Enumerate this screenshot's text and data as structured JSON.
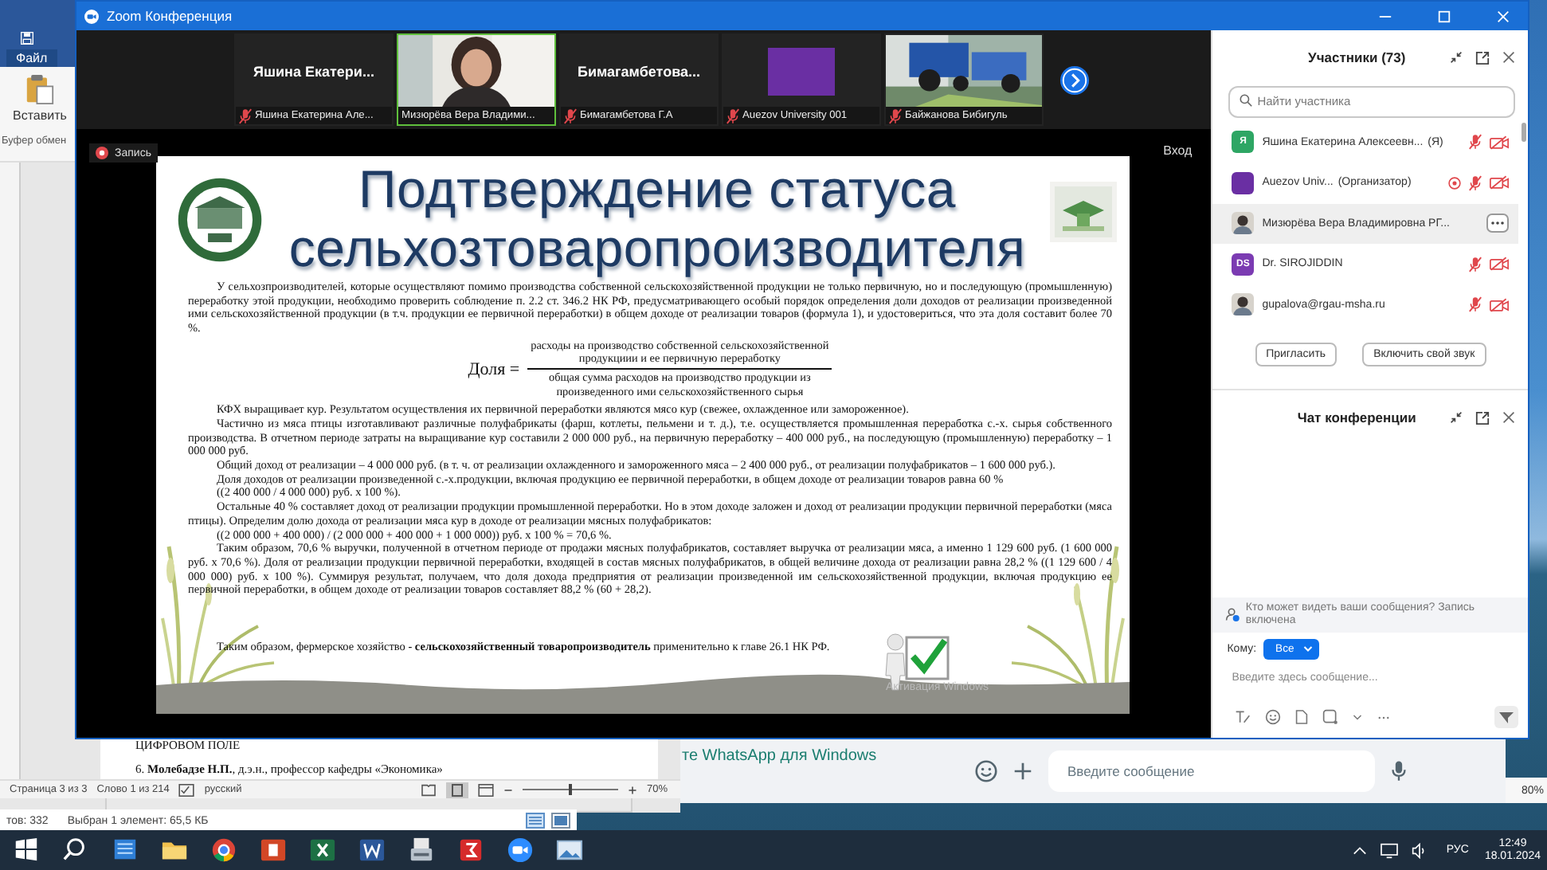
{
  "word_window": {
    "file_tab": "Файл",
    "paste_button": "Вставить",
    "clipboard_group": "Буфер обмен",
    "document_lines": [
      "ЦИФРОВОМ ПОЛЕ",
      "6. **Молебадзе Н.П.**, д.э.н., профессор кафедры «Экономика»"
    ],
    "status_bar": {
      "page": "Страница 3 из 3",
      "words": "Слово 1 из 214",
      "language": "русский",
      "zoom": "70%",
      "zoom_slider": {
        "level": 0.5
      }
    }
  },
  "explorer_status": {
    "items_count": "тов: 332",
    "selection": "Выбран 1 элемент: 65,5 КБ"
  },
  "whatsapp": {
    "banner": "те WhatsApp для Windows",
    "message_placeholder": "Введите сообщение"
  },
  "background_window": {
    "zoom": "80%"
  },
  "zoom_window": {
    "title": "Zoom Конференция",
    "video_tiles": [
      {
        "kind": "name",
        "display_name": "Яшина  Екатери...",
        "label": "Яшина Екатерина Але...",
        "muted": true,
        "speaking": false
      },
      {
        "kind": "video",
        "label": "Мизюрёва Вера Владими...",
        "muted": false,
        "speaking": true
      },
      {
        "kind": "name",
        "display_name": "Бимагамбетова...",
        "label": "Бимагамбетова Г.А",
        "muted": true,
        "speaking": false
      },
      {
        "kind": "avatar",
        "color": "#6a2fa3",
        "label": "Auezov University 001",
        "muted": true,
        "speaking": false
      },
      {
        "kind": "video",
        "label": "Байжанова Бибигуль",
        "muted": true,
        "speaking": false
      }
    ],
    "recording_label": "Запись",
    "exit_label": "Вход",
    "slide": {
      "title_lines": [
        "Подтверждение статуса",
        "сельхозтоваропроизводителя"
      ],
      "blocks": [
        {
          "kind": "paragraph",
          "text": "У сельхозпроизводителей, которые осуществляют помимо производства собственной сельскохозяйственной продукции не только первичную, но и последующую (промышленную) переработку этой продукции, необходимо проверить соблюдение п. 2.2 ст. 346.2 НК РФ, предусматривающего особый порядок определения доли доходов от реализации произведенной ими сельскохозяйственной продукции (в т.ч. продукции ее первичной переработки) в общем доходе от реализации товаров (формула 1), и удостовериться, что эта доля составит более 70 %."
        },
        {
          "kind": "formula",
          "lhs": "Доля =",
          "numerator": [
            "расходы на производство собственной  сельскохозяйственной",
            "продукциии и  ее первичную переработку"
          ],
          "denominator": [
            "общая сумма расходов на производство продукции из",
            "произведенного ими сельскохозяйственного сырья"
          ]
        },
        {
          "kind": "paragraph",
          "text": "КФХ выращивает кур. Результатом осуществления их первичной переработки являются мясо кур (свежее, охлажденное или замороженное)."
        },
        {
          "kind": "paragraph",
          "text": "Частично из мяса птицы изготавливают различные полуфабрикаты (фарш, котлеты, пельмени и т. д.), т.е. осуществляется промышленная переработка с.-х. сырья собственного производства. В отчетном периоде затраты на выращивание кур составили 2 000 000 руб., на первичную переработку – 400 000 руб., на последующую (промышленную) переработку – 1 000 000 руб."
        },
        {
          "kind": "paragraph",
          "text": "Общий доход от реализации – 4 000 000 руб. (в т. ч.  от реализации охлажденного и замороженного мяса – 2 400 000 руб., от реализации полуфабрикатов – 1 600 000 руб.)."
        },
        {
          "kind": "line",
          "text": "Доля доходов от реализации произведенной с.-х.продукции, включая продукцию ее первичной переработки, в общем доходе от реализации товаров равна 60 %"
        },
        {
          "kind": "line",
          "text": "((2 400 000 / 4 000 000) руб. х 100 %)."
        },
        {
          "kind": "paragraph",
          "text": "Остальные 40 % составляет доход от реализации продукции промышленной переработки. Но в этом доходе заложен и доход от реализации продукции первичной переработки (мяса птицы). Определим долю дохода от реализации мяса кур в доходе от реализации мясных полуфабрикатов:"
        },
        {
          "kind": "line",
          "text": "((2 000 000 + 400 000) / (2 000 000 + 400 000 + 1 000 000)) руб. х 100 % = 70,6 %."
        },
        {
          "kind": "paragraph",
          "text": "Таким образом, 70,6 % выручки, полученной в отчетном периоде от продажи мясных полуфабрикатов, составляет выручка от реализации мяса, а именно 1 129 600 руб. (1 600 000 руб. х 70,6 %). Доля от реализации продукции первичной переработки, входящей в состав мясных полуфабрикатов, в общей величине дохода от реализации равна 28,2 % ((1 129 600 / 4 000 000) руб. х 100 %). Суммируя результат, получаем, что доля дохода предприятия от реализации произведенной им сельскохозяйственной продукции, включая продукцию ее первичной переработки, в общем доходе от реализации товаров составляет 88,2 % (60 + 28,2)."
        },
        {
          "kind": "conclusion",
          "text": "Таким образом, фермерское хозяйство **- сельскохозяйственный  товаропроизводитель** применительно к главе 26.1 НК РФ."
        }
      ],
      "activation_notice": "Активация Windows"
    },
    "participants": {
      "title": "Участники (73)",
      "search_placeholder": "Найти участника",
      "rows": [
        {
          "avatar": {
            "kind": "letter",
            "text": "Я",
            "color": "#2ea664"
          },
          "name": "Яшина Екатерина Алексеевн...",
          "role": "(Я)",
          "recording": false,
          "muted": true,
          "video_off": true,
          "selected": false
        },
        {
          "avatar": {
            "kind": "letter",
            "color": "#6a2fa3"
          },
          "name": "Auezov Univ...",
          "role": "(Организатор)",
          "recording": true,
          "muted": true,
          "video_off": true,
          "selected": false
        },
        {
          "name": "Мизюрёва Вера Владимировна РГ...",
          "recording": false,
          "selected": true
        },
        {
          "avatar": {
            "kind": "letter",
            "text": "DS",
            "color": "#7b3bb2"
          },
          "name": "Dr.  SIROJIDDIN",
          "recording": false,
          "muted": true,
          "video_off": true,
          "selected": false
        },
        {
          "name": "gupalova@rgau-msha.ru",
          "recording": false,
          "muted": true,
          "video_off": true,
          "selected": false
        }
      ],
      "invite_button": "Пригласить",
      "unmute_button": "Включить свой звук"
    },
    "chat": {
      "title": "Чат конференции",
      "notice": "Кто может видеть ваши сообщения? Запись включена",
      "recipient_label": "Кому:",
      "recipient": "Все",
      "message_placeholder": "Введите здесь сообщение..."
    }
  },
  "taskbar": {
    "language": "РУС",
    "time": "12:49",
    "date": "18.01.2024"
  }
}
